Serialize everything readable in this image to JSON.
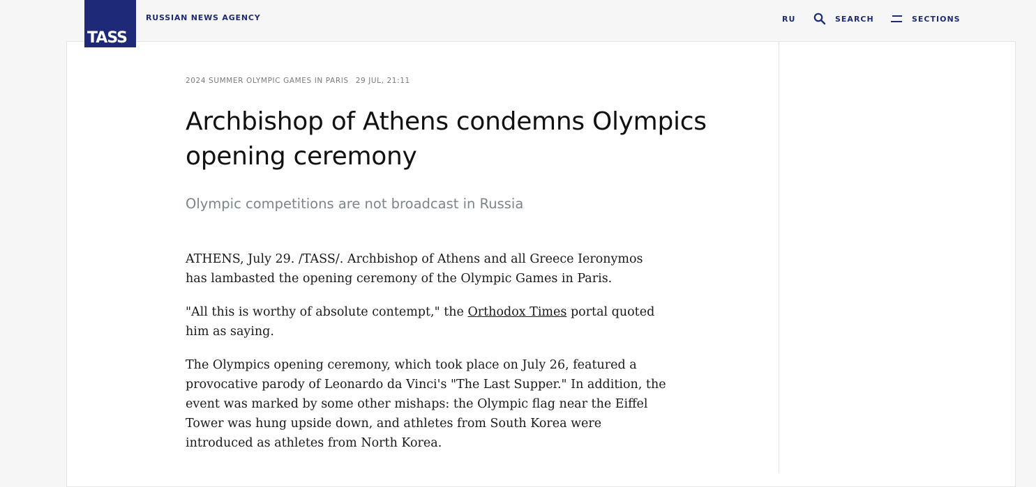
{
  "header": {
    "logo_text": "TASS",
    "agency_name": "RUSSIAN NEWS AGENCY",
    "nav": {
      "language": "RU",
      "search_label": "SEARCH",
      "sections_label": "SECTIONS"
    },
    "brand_color": "#1e2a78"
  },
  "article": {
    "rubric": "2024 SUMMER OLYMPIC GAMES IN PARIS",
    "date": "29 JUL, 21:11",
    "title": "Archbishop of Athens condemns Olympics opening ceremony",
    "lead": "Olympic competitions are not broadcast in Russia",
    "paragraph_1": "ATHENS, July 29. /TASS/. Archbishop of Athens and all Greece Ieronymos has lambasted the opening ceremony of the Olympic Games in Paris.",
    "paragraph_2_before_link": "\"All this is worthy of absolute contempt,\" the ",
    "paragraph_2_link": "Orthodox Times",
    "paragraph_2_after_link": " portal quoted him as saying.",
    "paragraph_3": "The Olympics opening ceremony, which took place on July 26, featured a provocative parody of Leonardo da Vinci's \"The Last Supper.\" In addition, the event was marked by some other mishaps: the Olympic flag near the Eiffel Tower was hung upside down, and athletes from South Korea were introduced as athletes from North Korea."
  },
  "icons": {
    "search": "search-icon",
    "sections": "menu-icon"
  }
}
